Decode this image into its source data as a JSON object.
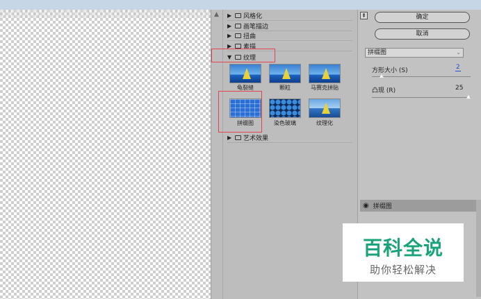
{
  "folders": {
    "stylize": "风格化",
    "brush_strokes": "画笔描边",
    "distort": "扭曲",
    "sketch": "素描",
    "texture": "纹理",
    "artistic": "艺术效果"
  },
  "texture_filters": [
    {
      "label": "龟裂缝"
    },
    {
      "label": "颗粒"
    },
    {
      "label": "马赛克拼贴"
    },
    {
      "label": "拼缀图"
    },
    {
      "label": "染色玻璃"
    },
    {
      "label": "纹理化"
    }
  ],
  "buttons": {
    "ok": "确定",
    "cancel": "取消"
  },
  "settings": {
    "filter_select": "拼缀图",
    "square_size_label": "方形大小 (S)",
    "square_size_value": "2",
    "relief_label": "凸现 (R)",
    "relief_value": "25"
  },
  "sliders": {
    "square_size": 0.1,
    "relief": 1.0
  },
  "layers": {
    "effect_name": "拼缀图"
  },
  "watermark": {
    "main": "百科全说",
    "sub": "助你轻松解决"
  },
  "colors": {
    "highlight": "#e0454f",
    "watermark": "#1aa37a"
  }
}
